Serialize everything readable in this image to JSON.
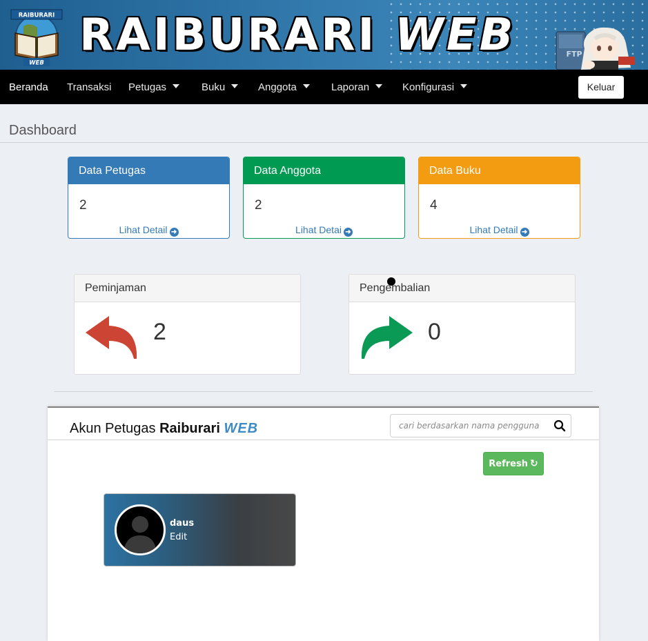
{
  "brand": {
    "title_part1": "RAIBURARI",
    "title_part2": "WEB",
    "logo_top_text": "RAIBURARI",
    "logo_bottom_text": "WEB",
    "mascot_book_text": "FTP"
  },
  "nav": {
    "items": [
      {
        "label": "Beranda",
        "active": true,
        "dropdown": false
      },
      {
        "label": "Transaksi",
        "active": false,
        "dropdown": false
      },
      {
        "label": "Petugas",
        "active": false,
        "dropdown": true
      },
      {
        "label": "Buku",
        "active": false,
        "dropdown": true
      },
      {
        "label": "Anggota",
        "active": false,
        "dropdown": true
      },
      {
        "label": "Laporan",
        "active": false,
        "dropdown": true
      },
      {
        "label": "Konfigurasi",
        "active": false,
        "dropdown": true
      }
    ],
    "logout_label": "Keluar"
  },
  "page": {
    "title": "Dashboard"
  },
  "stats": [
    {
      "title": "Data Petugas",
      "value": "2",
      "link": "Lihat Detail",
      "color": "#337ab7"
    },
    {
      "title": "Data Anggota",
      "value": "2",
      "link": "Lihat Detai",
      "color": "#009a52"
    },
    {
      "title": "Data Buku",
      "value": "4",
      "link": "Lihat Detail",
      "color": "#f39c12"
    }
  ],
  "transactions": {
    "loan": {
      "title": "Peminjaman",
      "value": "2",
      "color": "#cc4433",
      "icon": "reply-arrow-icon"
    },
    "return": {
      "title": "Pengembalian",
      "value": "0",
      "color": "#0a9a55",
      "icon": "share-arrow-icon"
    }
  },
  "accounts": {
    "title_prefix": "Akun Petugas",
    "title_brand": "Raiburari",
    "title_suffix": "WEB",
    "search_placeholder": "cari berdasarkan nama pengguna",
    "refresh_label": "Refresh",
    "users": [
      {
        "name": "daus",
        "edit_label": "Edit"
      }
    ]
  }
}
